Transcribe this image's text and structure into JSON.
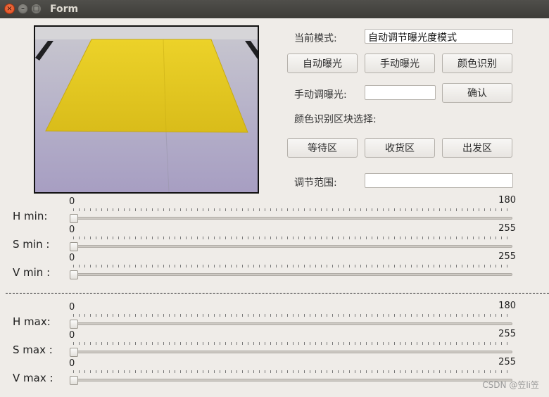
{
  "window": {
    "title": "Form"
  },
  "controls": {
    "mode_label": "当前模式:",
    "mode_value": "自动调节曝光度模式",
    "auto_exposure_button": "自动曝光",
    "manual_exposure_button": "手动曝光",
    "color_recognition_button": "颜色识别",
    "manual_exposure_label": "手动调曝光:",
    "manual_exposure_value": "",
    "confirm_button": "确认",
    "region_label": "颜色识别区块选择:",
    "wait_zone_button": "等待区",
    "receive_zone_button": "收货区",
    "depart_zone_button": "出发区",
    "range_label": "调节范围:",
    "range_value": ""
  },
  "sliders": [
    {
      "label": "H  min:",
      "value": 0,
      "min_label": "0",
      "max_label": "180"
    },
    {
      "label": "S  min :",
      "value": 0,
      "min_label": "0",
      "max_label": "255"
    },
    {
      "label": "V  min :",
      "value": 0,
      "min_label": "0",
      "max_label": "255"
    },
    {
      "label": "H  max:",
      "value": 0,
      "min_label": "0",
      "max_label": "180"
    },
    {
      "label": "S  max :",
      "value": 0,
      "min_label": "0",
      "max_label": "255"
    },
    {
      "label": "V  max :",
      "value": 0,
      "min_label": "0",
      "max_label": "255"
    }
  ],
  "watermark": "CSDN @笠li笠",
  "colors": {
    "window_bg": "#efece8",
    "titlebar": "#3d3c38",
    "close_button": "#e0461c",
    "preview_paper": "#e3c81e"
  }
}
